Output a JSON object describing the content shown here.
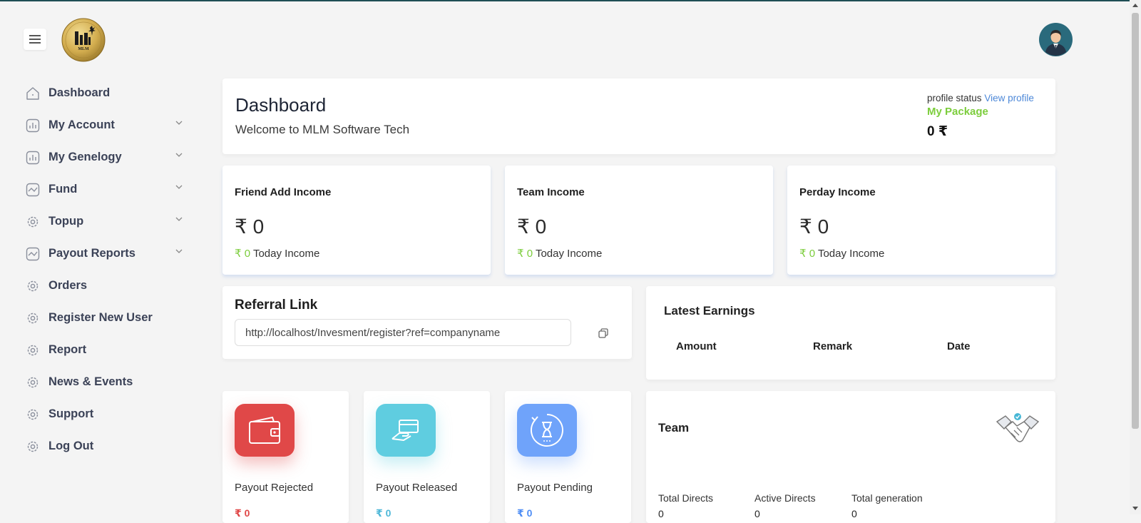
{
  "header": {
    "menu_icon": "hamburger-icon",
    "logo_text": "MLM",
    "avatar_icon": "user-avatar"
  },
  "sidebar": {
    "items": [
      {
        "label": "Dashboard",
        "icon": "home-icon",
        "has_chevron": false
      },
      {
        "label": "My Account",
        "icon": "bar-chart-icon",
        "has_chevron": true
      },
      {
        "label": "My Genelogy",
        "icon": "bar-chart-icon",
        "has_chevron": true
      },
      {
        "label": "Fund",
        "icon": "line-chart-icon",
        "has_chevron": true
      },
      {
        "label": "Topup",
        "icon": "gear-icon",
        "has_chevron": true
      },
      {
        "label": "Payout Reports",
        "icon": "line-chart-icon",
        "has_chevron": true
      },
      {
        "label": "Orders",
        "icon": "gear-icon",
        "has_chevron": false
      },
      {
        "label": "Register New User",
        "icon": "gear-icon",
        "has_chevron": false
      },
      {
        "label": "Report",
        "icon": "gear-icon",
        "has_chevron": false
      },
      {
        "label": "News & Events",
        "icon": "gear-icon",
        "has_chevron": false
      },
      {
        "label": "Support",
        "icon": "gear-icon",
        "has_chevron": false
      },
      {
        "label": "Log Out",
        "icon": "gear-icon",
        "has_chevron": false
      }
    ]
  },
  "dashboard": {
    "title": "Dashboard",
    "welcome": "Welcome to MLM Software Tech",
    "profile_status_label": "profile status",
    "view_profile_link": "View profile",
    "package_label": "My Package",
    "package_value": "0 ₹"
  },
  "income_cards": [
    {
      "title": "Friend Add Income",
      "value": "₹ 0",
      "today_value": "₹ 0",
      "today_label": "Today Income"
    },
    {
      "title": "Team Income",
      "value": "₹ 0",
      "today_value": "₹ 0",
      "today_label": "Today Income"
    },
    {
      "title": "Perday Income",
      "value": "₹ 0",
      "today_value": "₹ 0",
      "today_label": "Today Income"
    }
  ],
  "referral": {
    "title": "Referral Link",
    "link": "http://localhost/Invesment/register?ref=companyname",
    "copy_icon": "copy-icon"
  },
  "latest_earnings": {
    "title": "Latest Earnings",
    "columns": [
      "Amount",
      "Remark",
      "Date"
    ]
  },
  "payout_cards": [
    {
      "label": "Payout Rejected",
      "value": "₹ 0",
      "icon": "wallet-icon",
      "color": "#e04848",
      "value_color": "#e04848"
    },
    {
      "label": "Payout Released",
      "value": "₹ 0",
      "icon": "card-hand-icon",
      "color": "#5fcde0",
      "value_color": "#4fb8d8"
    },
    {
      "label": "Payout Pending",
      "value": "₹ 0",
      "icon": "hourglass-icon",
      "color": "#6fa3fa",
      "value_color": "#4f8ef5"
    }
  ],
  "team": {
    "title": "Team",
    "icon": "handshake-icon",
    "stats": [
      {
        "label": "Total Directs",
        "value": "0"
      },
      {
        "label": "Active Directs",
        "value": "0"
      },
      {
        "label": "Total generation",
        "value": "0"
      }
    ]
  },
  "colors": {
    "accent_green": "#7ccd3c",
    "link_blue": "#4d88d8",
    "sidebar_text": "#3b4257"
  }
}
